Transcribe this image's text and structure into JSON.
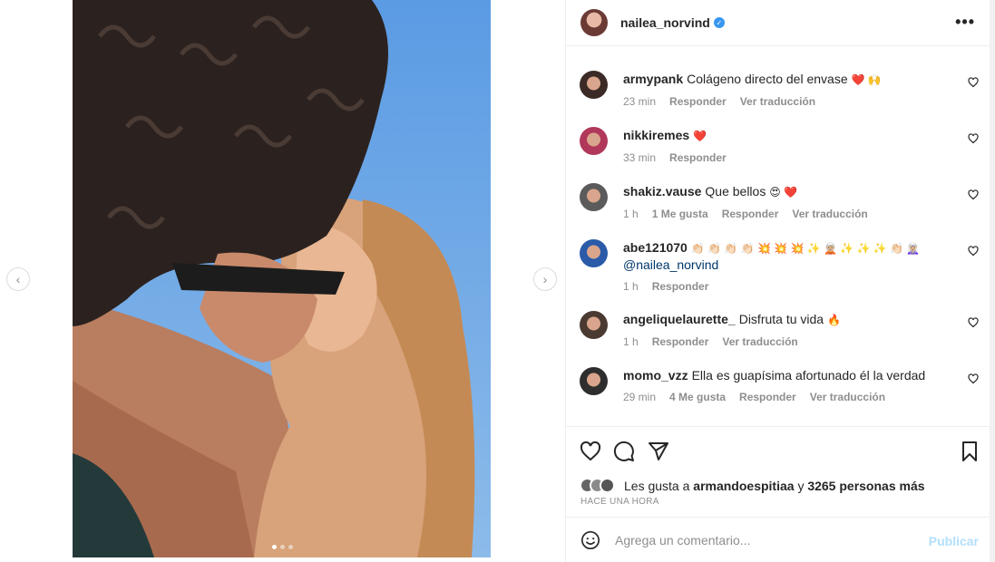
{
  "post": {
    "username": "nailea_norvind",
    "verified_glyph": "✓",
    "more_glyph": "•••"
  },
  "media": {
    "prev_glyph": "‹",
    "next_glyph": "›",
    "carousel_dots": 3,
    "active_dot": 1
  },
  "comments": [
    {
      "user": "armypank",
      "text": "Colágeno directo del envase",
      "emoji": "❤️ 🙌",
      "time": "23 min",
      "likes": "",
      "reply": "Responder",
      "translate": "Ver traducción",
      "avatar_color": "#3b2a25"
    },
    {
      "user": "nikkiremes",
      "text": "",
      "emoji": "❤️",
      "time": "33 min",
      "likes": "",
      "reply": "Responder",
      "translate": "",
      "avatar_color": "#b0385a"
    },
    {
      "user": "shakiz.vause",
      "text": "Que bellos",
      "emoji": "😍 ❤️",
      "time": "1 h",
      "likes": "1 Me gusta",
      "reply": "Responder",
      "translate": "Ver traducción",
      "avatar_color": "#5b5b5b"
    },
    {
      "user": "abe121070",
      "text": "",
      "emoji": "👏🏻 👏🏻 👏🏻 👏🏻 💥 💥 💥 ✨ 🧝🏼 ✨ ✨ ✨ 👏🏻 🧝🏼‍♀️",
      "mention": "@nailea_norvind",
      "time": "1 h",
      "likes": "",
      "reply": "Responder",
      "translate": "",
      "avatar_color": "#2a5aa8"
    },
    {
      "user": "angeliquelaurette_",
      "text": "Disfruta tu vida",
      "emoji": "🔥",
      "time": "1 h",
      "likes": "",
      "reply": "Responder",
      "translate": "Ver traducción",
      "avatar_color": "#4a3a32"
    },
    {
      "user": "momo_vzz",
      "text": "Ella es guapísima afortunado él la verdad",
      "emoji": "",
      "time": "29 min",
      "likes": "4 Me gusta",
      "reply": "Responder",
      "translate": "Ver traducción",
      "avatar_color": "#2e2e2e"
    }
  ],
  "likes": {
    "prefix": "Les gusta a",
    "liker": "armandoespitiaa",
    "connector": "y",
    "others": "3265 personas más",
    "time_ago": "HACE UNA HORA"
  },
  "composer": {
    "placeholder": "Agrega un comentario...",
    "publish_label": "Publicar"
  },
  "icons": {
    "like": "heart-icon",
    "comment": "comment-icon",
    "share": "send-icon",
    "save": "bookmark-icon",
    "emoji": "emoji-icon"
  },
  "colors": {
    "verified": "#3897f0",
    "publish_disabled": "#b2dffc",
    "meta_text": "#8e8e8e",
    "mention": "#00376b"
  }
}
